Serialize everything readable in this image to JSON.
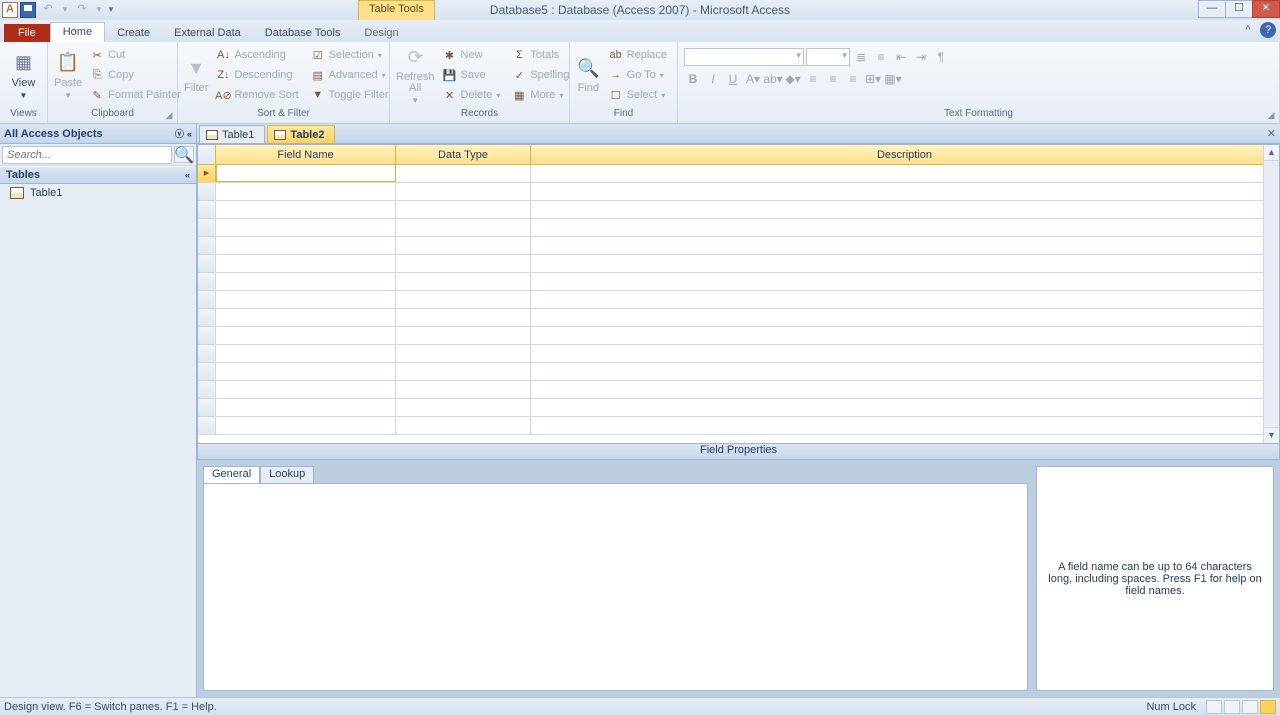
{
  "title": "Database5 : Database (Access 2007) - Microsoft Access",
  "context_tab": "Table Tools",
  "tabs": {
    "file": "File",
    "home": "Home",
    "create": "Create",
    "external": "External Data",
    "dbtools": "Database Tools",
    "design": "Design"
  },
  "ribbon": {
    "views": {
      "view": "View",
      "group": "Views"
    },
    "clipboard": {
      "paste": "Paste",
      "cut": "Cut",
      "copy": "Copy",
      "fmt": "Format Painter",
      "group": "Clipboard"
    },
    "sort": {
      "filter": "Filter",
      "asc": "Ascending",
      "desc": "Descending",
      "remove": "Remove Sort",
      "sel": "Selection",
      "adv": "Advanced",
      "toggle": "Toggle Filter",
      "group": "Sort & Filter"
    },
    "records": {
      "refresh": "Refresh\nAll",
      "new": "New",
      "save": "Save",
      "delete": "Delete",
      "totals": "Totals",
      "spelling": "Spelling",
      "more": "More",
      "group": "Records"
    },
    "find": {
      "find": "Find",
      "replace": "Replace",
      "goto": "Go To",
      "select": "Select",
      "group": "Find"
    },
    "text": {
      "group": "Text Formatting"
    }
  },
  "nav": {
    "header": "All Access Objects",
    "search_placeholder": "Search...",
    "group": "Tables",
    "item1": "Table1"
  },
  "doc": {
    "tab1": "Table1",
    "tab2": "Table2"
  },
  "grid": {
    "fn": "Field Name",
    "dt": "Data Type",
    "desc": "Description"
  },
  "fp": {
    "title": "Field Properties",
    "general": "General",
    "lookup": "Lookup",
    "help": "A field name can be up to 64 characters long, including spaces. Press F1 for help on field names."
  },
  "status": {
    "left": "Design view.   F6 = Switch panes.   F1 = Help.",
    "numlock": "Num Lock"
  }
}
